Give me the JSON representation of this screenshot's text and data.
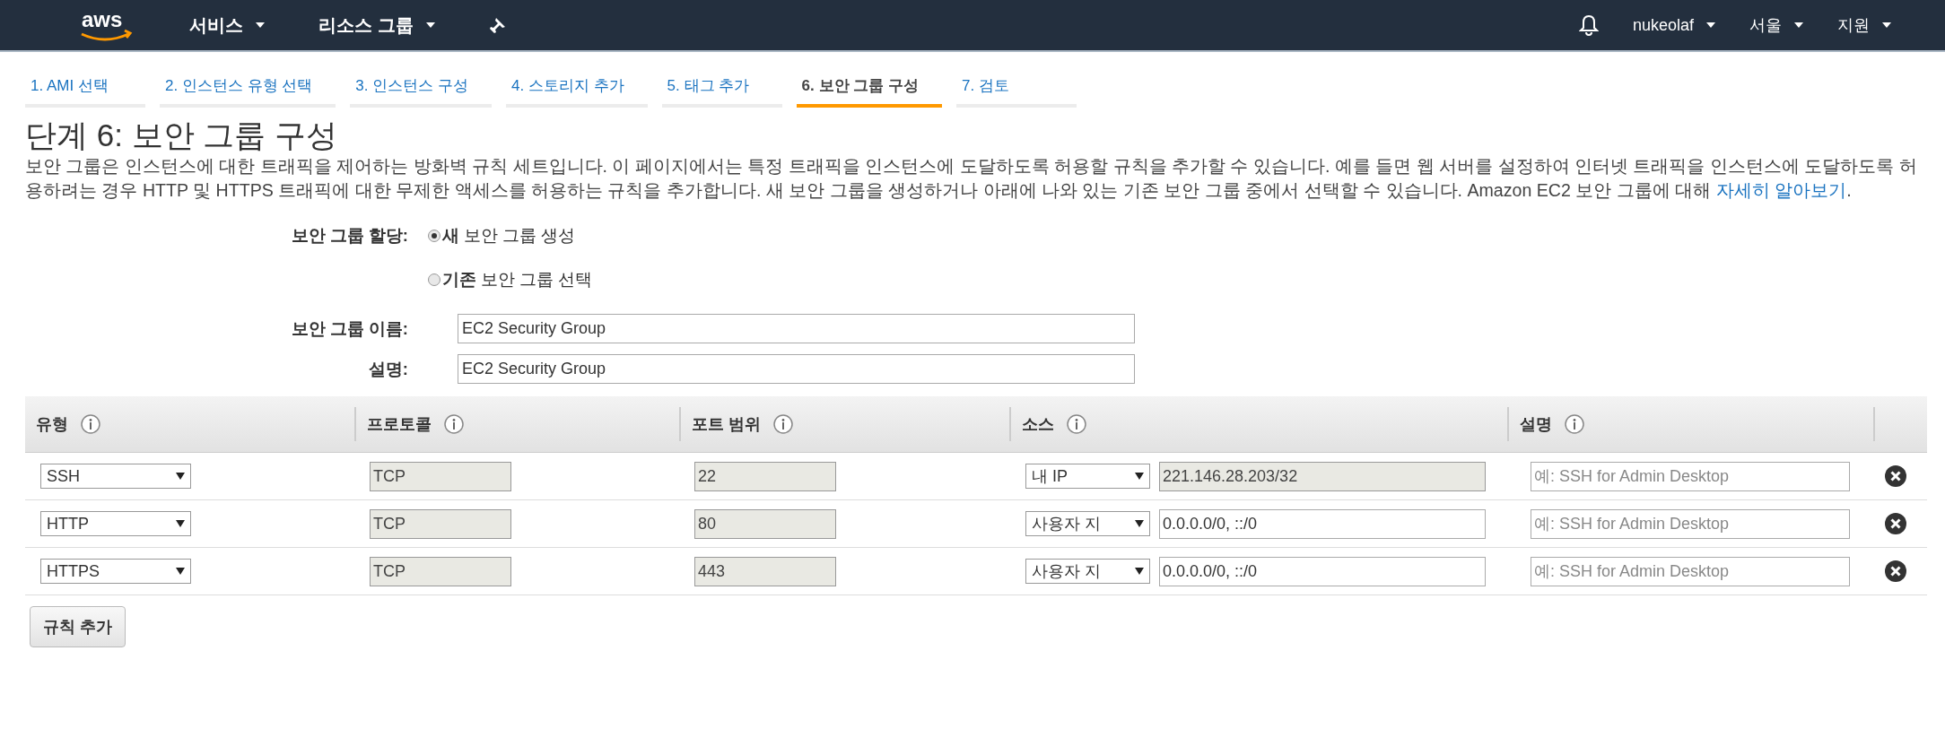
{
  "top_nav": {
    "logo": "aws",
    "menus": [
      {
        "label": "서비스"
      },
      {
        "label": "리소스 그룹"
      }
    ],
    "user": "nukeolaf",
    "region": "서울",
    "support": "지원"
  },
  "steps": [
    {
      "label": "1. AMI 선택",
      "selected": false
    },
    {
      "label": "2. 인스턴스 유형 선택",
      "selected": false
    },
    {
      "label": "3. 인스턴스 구성",
      "selected": false
    },
    {
      "label": "4. 스토리지 추가",
      "selected": false
    },
    {
      "label": "5. 태그 추가",
      "selected": false
    },
    {
      "label": "6. 보안 그룹 구성",
      "selected": true
    },
    {
      "label": "7. 검토",
      "selected": false
    }
  ],
  "title": "단계 6: 보안 그룹 구성",
  "description": "보안 그룹은 인스턴스에 대한 트래픽을 제어하는 방화벽 규칙 세트입니다. 이 페이지에서는 특정 트래픽을 인스턴스에 도달하도록 허용할 규칙을 추가할 수 있습니다. 예를 들면 웹 서버를 설정하여 인터넷 트래픽을 인스턴스에 도달하도록 허용하려는 경우 HTTP 및 HTTPS 트래픽에 대한 무제한 액세스를 허용하는 규칙을 추가합니다. 새 보안 그룹을 생성하거나 아래에 나와 있는 기존 보안 그룹 중에서 선택할 수 있습니다. Amazon EC2 보안 그룹에 대해 ",
  "learn_more": "자세히 알아보기",
  "learn_more_suffix": ".",
  "assign": {
    "label": "보안 그룹 할당:",
    "options": [
      {
        "label": "**새** 보안 그룹 생성",
        "selected": true
      },
      {
        "label": "**기존** 보안 그룹 선택",
        "selected": false
      }
    ]
  },
  "fields": [
    {
      "label": "보안 그룹 이름:",
      "value": "EC2 Security Group"
    },
    {
      "label": "설명:",
      "value": "EC2 Security Group"
    }
  ],
  "table": {
    "columns": [
      "유형",
      "프로토콜",
      "포트 범위",
      "소스",
      "설명"
    ],
    "rows": [
      {
        "type": "SSH",
        "protocol": "TCP",
        "port": "22",
        "source_type": "내 IP",
        "source": "221.146.28.203/32",
        "source_disabled": true,
        "description_placeholder": "예: SSH for Admin Desktop"
      },
      {
        "type": "HTTP",
        "protocol": "TCP",
        "port": "80",
        "source_type": "사용자 지",
        "source": "0.0.0.0/0, ::/0",
        "source_disabled": false,
        "description_placeholder": "예: SSH for Admin Desktop"
      },
      {
        "type": "HTTPS",
        "protocol": "TCP",
        "port": "443",
        "source_type": "사용자 지",
        "source": "0.0.0.0/0, ::/0",
        "source_disabled": false,
        "description_placeholder": "예: SSH for Admin Desktop"
      }
    ]
  },
  "add_rule_button": "규칙 추가"
}
